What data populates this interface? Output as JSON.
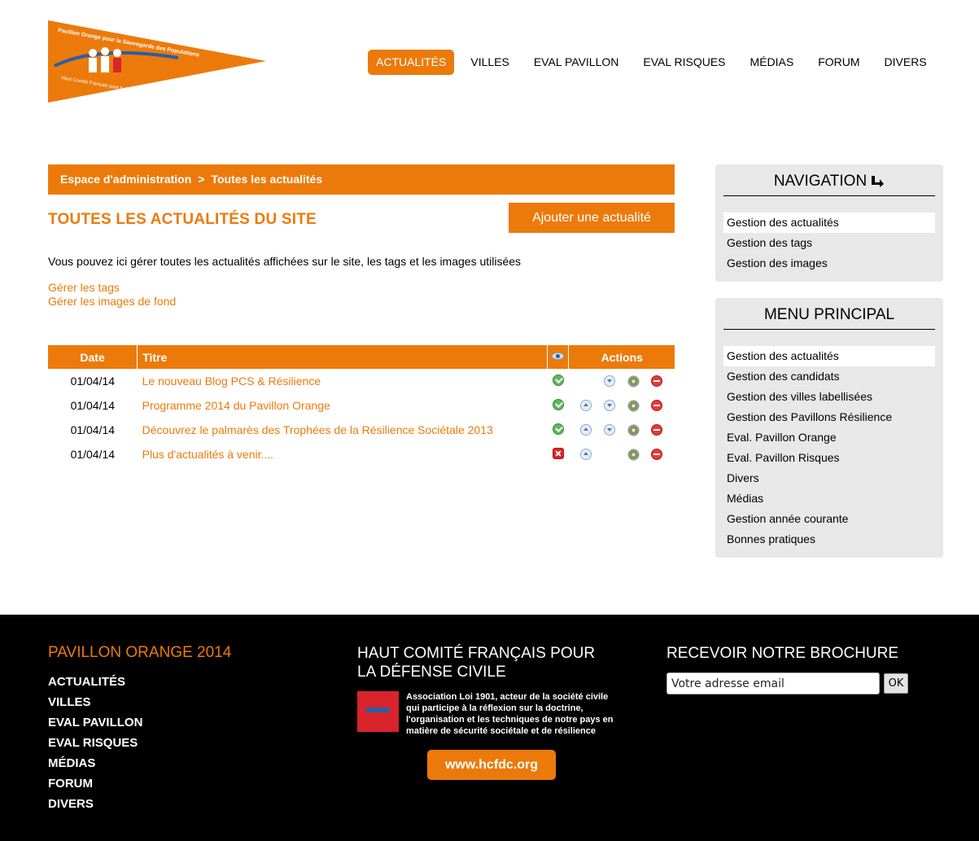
{
  "brand": {
    "pennant_top_text": "Pavillon Orange pour la Sauvegarde des Populations",
    "pennant_bottom_text": "Haut Comité Français pour la Défense Civile",
    "orange": "#ec7a0a"
  },
  "topnav": {
    "items": [
      {
        "label": "ACTUALITÉS",
        "active": true
      },
      {
        "label": "VILLES"
      },
      {
        "label": "EVAL PAVILLON"
      },
      {
        "label": "EVAL RISQUES"
      },
      {
        "label": "MÉDIAS"
      },
      {
        "label": "FORUM"
      },
      {
        "label": "DIVERS"
      }
    ]
  },
  "breadcrumb": {
    "root": "Espace d'administration",
    "separator": ">",
    "current": "Toutes les actualités"
  },
  "main": {
    "title": "TOUTES LES ACTUALITÉS DU SITE",
    "add_button": "Ajouter une actualité",
    "intro": "Vous pouvez ici gérer toutes les actualités affichées sur le site, les tags et les images utilisées",
    "links": [
      "Gérer les tags",
      "Gérer les images de fond"
    ]
  },
  "table": {
    "headers": {
      "date": "Date",
      "title": "Titre",
      "visibility_icon": "eye-icon",
      "actions": "Actions"
    },
    "rows": [
      {
        "date": "01/04/14",
        "title": "Le nouveau Blog PCS & Résilience",
        "visible": true,
        "up": false,
        "down": true
      },
      {
        "date": "01/04/14",
        "title": "Programme 2014 du Pavillon Orange",
        "visible": true,
        "up": true,
        "down": true
      },
      {
        "date": "01/04/14",
        "title": "Découvrez le palmarès des Trophées de la Résilience Sociétale 2013",
        "visible": true,
        "up": true,
        "down": true
      },
      {
        "date": "01/04/14",
        "title": "Plus d'actualités à venir....",
        "visible": false,
        "up": true,
        "down": false
      }
    ]
  },
  "sidebar": {
    "navigation": {
      "title": "NAVIGATION",
      "items": [
        "Gestion des actualités",
        "Gestion des tags",
        "Gestion des images"
      ]
    },
    "menu": {
      "title": "MENU PRINCIPAL",
      "items": [
        "Gestion des actualités",
        "Gestion des candidats",
        "Gestion des villes labellisées",
        "Gestion des Pavillons Résilience",
        "Eval. Pavillon Orange",
        "Eval. Pavillon Risques",
        "Divers",
        "Médias",
        "Gestion année courante",
        "Bonnes pratiques"
      ]
    }
  },
  "footer": {
    "col1": {
      "title": "PAVILLON ORANGE 2014",
      "links": [
        "ACTUALITÉS",
        "VILLES",
        "EVAL PAVILLON",
        "EVAL RISQUES",
        "MÉDIAS",
        "FORUM",
        "DIVERS"
      ]
    },
    "col2": {
      "title_line1": "HAUT COMITÉ FRANÇAIS POUR",
      "title_line2": "LA DÉFENSE CIVILE",
      "text": "Association Loi 1901, acteur de la société civile qui participe à la réflexion sur la doctrine, l'organisation et les techniques de notre pays en matière de sécurité sociétale et de résilience",
      "website": "www.hcfdc.org"
    },
    "col3": {
      "title": "RECEVOIR NOTRE BROCHURE",
      "email_placeholder": "Votre adresse email",
      "ok_label": "OK"
    }
  }
}
